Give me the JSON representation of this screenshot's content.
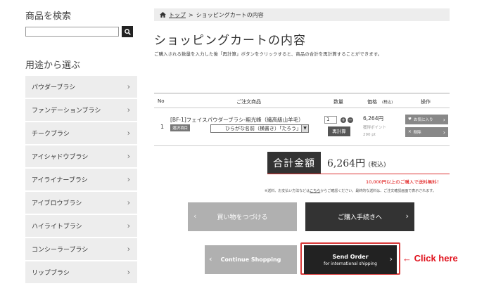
{
  "sidebar": {
    "search_title": "商品を検索",
    "search_value": "",
    "category_title": "用途から選ぶ",
    "items": [
      {
        "label": "パウダーブラシ"
      },
      {
        "label": "ファンデーションブラシ"
      },
      {
        "label": "チークブラシ"
      },
      {
        "label": "アイシャドウブラシ"
      },
      {
        "label": "アイライナーブラシ"
      },
      {
        "label": "アイブロウブラシ"
      },
      {
        "label": "ハイライトブラシ"
      },
      {
        "label": "コンシーラーブラシ"
      },
      {
        "label": "リップブラシ"
      }
    ]
  },
  "breadcrumb": {
    "home": "トップ",
    "sep": ">",
    "current": "ショッピングカートの内容"
  },
  "page": {
    "title": "ショッピングカートの内容",
    "description": "ご購入される数量を入力した後「再計算」ボタンをクリックすると、商品の合計を再計算することができます。"
  },
  "cart": {
    "headers": {
      "no": "No",
      "item": "ご注文商品",
      "qty": "数量",
      "price": "価格",
      "price_note": "(税込)",
      "ops": "操作"
    },
    "row": {
      "no": "1",
      "name": "[BF-1]フェイスパウダーブラシ-粗光峰（繊高級山羊毛）",
      "tag": "選択項目",
      "select_value": "ひらがな名前（横書き）「たろう」",
      "qty": "1",
      "plus": "+",
      "minus": "−",
      "recalc": "再計算",
      "price": "6,264円",
      "points_label": "獲得ポイント",
      "points": "290 pt",
      "fav": "お気に入り",
      "delete": "削除"
    }
  },
  "total": {
    "label": "合計金額",
    "amount": "6,264円",
    "tax": "(税込)",
    "free_shipping": "10,000円以上のご購入で送料無料！",
    "notes_pre": "※送料、お支払い方法などは",
    "notes_link": "こちら",
    "notes_post": "からご確認ください。最終的な送料は、ご注文確認画面で表示されます。"
  },
  "buttons": {
    "continue_jp": "買い物をつづける",
    "checkout": "ご購入手続きへ",
    "continue_en": "Continue Shopping",
    "send_line1": "Send Order",
    "send_line2": "for international shipping",
    "chev_left": "‹",
    "chev_right": "›"
  },
  "annotation": {
    "click_here": "← Click here",
    "color": "#e0121d"
  }
}
